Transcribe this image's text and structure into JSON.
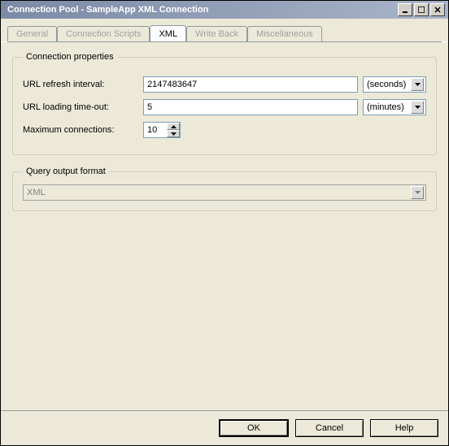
{
  "window": {
    "title": "Connection Pool - SampleApp XML Connection"
  },
  "tabs": {
    "general": "General",
    "scripts": "Connection Scripts",
    "xml": "XML",
    "writeback": "Write Back",
    "misc": "Miscellaneous"
  },
  "connection_props": {
    "legend": "Connection properties",
    "url_refresh_label": "URL refresh interval:",
    "url_refresh_value": "2147483647",
    "url_refresh_unit": "(seconds)",
    "url_timeout_label": "URL loading time-out:",
    "url_timeout_value": "5",
    "url_timeout_unit": "(minutes)",
    "max_conn_label": "Maximum connections:",
    "max_conn_value": "10"
  },
  "query_output": {
    "legend": "Query output format",
    "value": "XML"
  },
  "buttons": {
    "ok": "OK",
    "cancel": "Cancel",
    "help": "Help"
  }
}
